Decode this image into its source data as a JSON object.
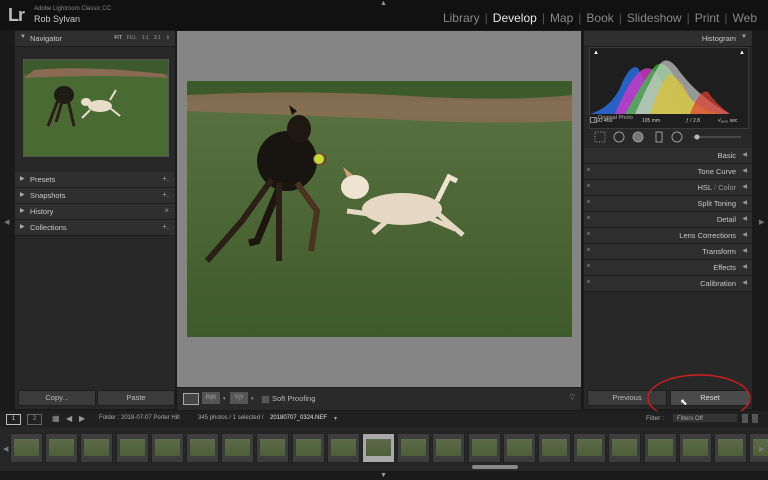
{
  "app": {
    "logo": "Lr",
    "name": "Adobe Lightroom Classic CC",
    "user": "Rob Sylvan",
    "modules": [
      {
        "label": "Library",
        "active": false
      },
      {
        "label": "Develop",
        "active": true
      },
      {
        "label": "Map",
        "active": false
      },
      {
        "label": "Book",
        "active": false
      },
      {
        "label": "Slideshow",
        "active": false
      },
      {
        "label": "Print",
        "active": false
      },
      {
        "label": "Web",
        "active": false
      }
    ],
    "separator": "|"
  },
  "left_panel": {
    "navigator": {
      "label": "Navigator",
      "zoom_options": [
        "FIT",
        "FILL",
        "1:1",
        "3:1"
      ],
      "zoom_menu": "⇕"
    },
    "panels": [
      {
        "label": "Presets",
        "action": "+."
      },
      {
        "label": "Snapshots",
        "action": "+."
      },
      {
        "label": "History",
        "action": "×"
      },
      {
        "label": "Collections",
        "action": "+."
      }
    ],
    "copy_button": "Copy...",
    "paste_button": "Paste"
  },
  "toolbar": {
    "soft_proofing_label": "Soft Proofing",
    "view_icons": [
      "loupe-view-icon",
      "before-after-lr-icon",
      "before-after-tb-icon"
    ],
    "compare_labels": [
      "R|R",
      "Y|Y"
    ]
  },
  "right_panel": {
    "histogram": {
      "label": "Histogram",
      "iso": "ISO 400",
      "focal": "105 mm",
      "aperture": "ƒ / 2.8",
      "shutter": "¹⁄₁₆₀₀ sec",
      "original_photo": "Original Photo"
    },
    "sections": [
      {
        "label": "Basic"
      },
      {
        "label": "Tone Curve"
      },
      {
        "label": "HSL / Color",
        "segments": [
          "HSL",
          " / ",
          "Color"
        ]
      },
      {
        "label": "Split Toning"
      },
      {
        "label": "Detail"
      },
      {
        "label": "Lens Corrections"
      },
      {
        "label": "Transform"
      },
      {
        "label": "Effects"
      },
      {
        "label": "Calibration"
      }
    ],
    "previous_button": "Previous",
    "reset_button": "Reset"
  },
  "filmstrip_bar": {
    "view_numbers": [
      "1",
      "2"
    ],
    "folder_text": "Folder : 2018-07-07 Porter Hill",
    "count_text": "345 photos / 1 selected /",
    "filename": "20180707_0324.NEF",
    "filename_arrow": "▾",
    "filter_label": "Filter :",
    "filter_value": "Filters Off"
  },
  "filmstrip": {
    "thumb_count": 22,
    "selected_index": 10
  },
  "colors": {
    "accent_active": "#e8e8e8",
    "annotation_red": "#cc1f1f",
    "panel_bg": "#282828",
    "center_bg": "#858585"
  }
}
